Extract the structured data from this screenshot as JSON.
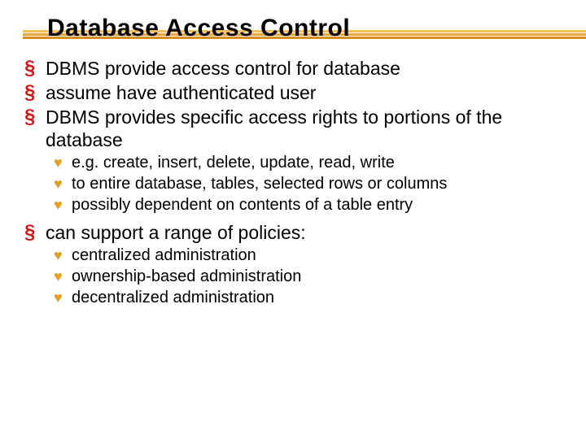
{
  "title": "Database Access Control",
  "bullets": {
    "b1": "DBMS provide access control for database",
    "b2": "assume have authenticated user",
    "b3": "DBMS provides specific access rights to portions of the database",
    "b3a": "e.g. create, insert, delete, update, read, write",
    "b3b": "to entire database, tables, selected rows or columns",
    "b3c": "possibly dependent on contents of a table entry",
    "b4": "can support a range of policies:",
    "b4a": "centralized administration",
    "b4b": "ownership-based administration",
    "b4c": "decentralized administration"
  },
  "icons": {
    "section": "§",
    "heart": "♥"
  },
  "colors": {
    "section_bullet": "#d01818",
    "heart_bullet": "#e0a020",
    "underline1": "#f4c05a",
    "underline2": "#e8a63a",
    "underline3": "#d98f1f"
  }
}
